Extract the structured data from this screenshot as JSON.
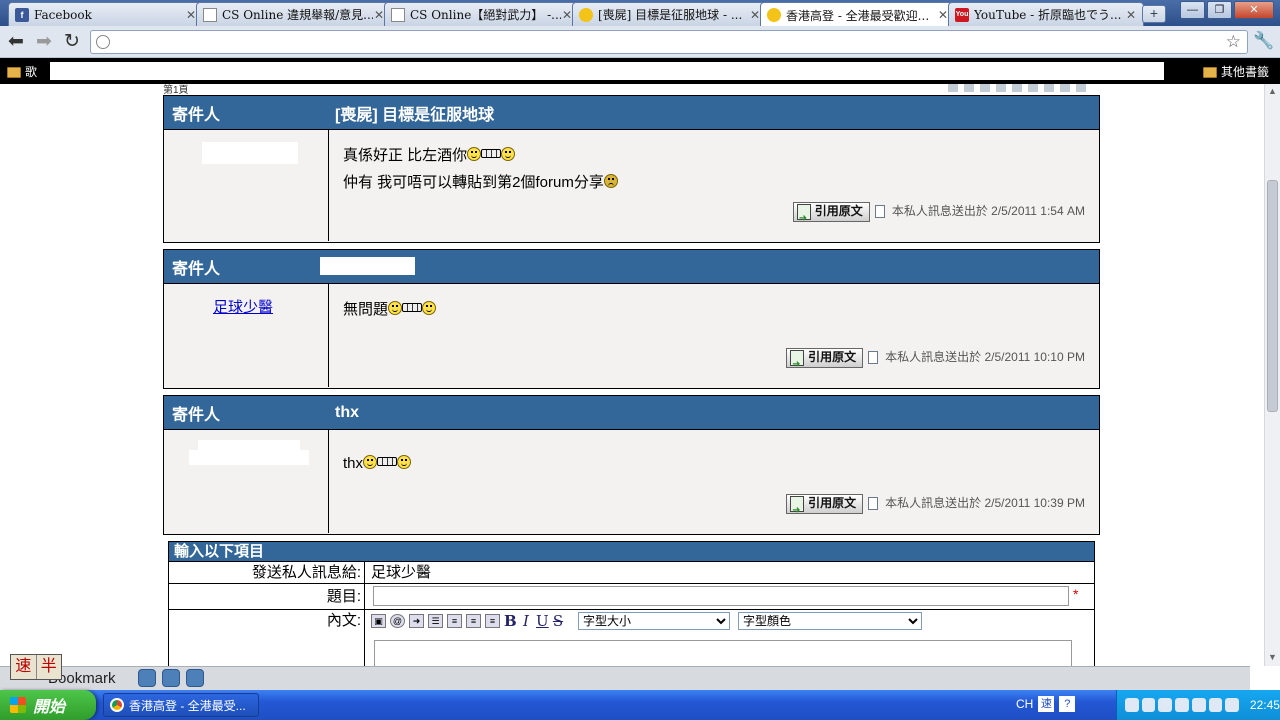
{
  "browser": {
    "tabs": [
      {
        "title": "Facebook",
        "icon": "facebook-icon",
        "active": false
      },
      {
        "title": "CS Online 違規舉報/意見...",
        "icon": "page-icon",
        "active": false
      },
      {
        "title": "CS Online【絕對武力】 -...",
        "icon": "page-icon",
        "active": false
      },
      {
        "title": "[喪屍] 目標是征服地球 - ...",
        "icon": "site-icon",
        "active": false
      },
      {
        "title": "香港高登 - 全港最受歡迎...",
        "icon": "site-icon",
        "active": true
      },
      {
        "title": "YouTube - 折原臨也でう...",
        "icon": "youtube-icon",
        "active": false
      }
    ],
    "new_tab": "+",
    "url": "",
    "bookmarks_left": "歌",
    "bookmarks_other": "其他書籤",
    "window_min": "—",
    "window_max": "❐",
    "window_close": "✕"
  },
  "page": {
    "pager_label": "第1頁",
    "messages": [
      {
        "from_label": "寄件人",
        "subject": "[喪屍] 目標是征服地球",
        "sender": "",
        "line1": "真係好正 比左酒你",
        "line2": "仲有 我可唔可以轉貼到第2個forum分享",
        "quote_label": "引用原文",
        "sent": "本私人訊息送出於 2/5/2011 1:54 AM"
      },
      {
        "from_label": "寄件人",
        "subject": "",
        "sender": "足球少醫",
        "line1": "無問題",
        "quote_label": "引用原文",
        "sent": "本私人訊息送出於 2/5/2011 10:10 PM"
      },
      {
        "from_label": "寄件人",
        "subject": "thx",
        "sender": "",
        "line1": "thx",
        "quote_label": "引用原文",
        "sent": "本私人訊息送出於 2/5/2011 10:39 PM"
      }
    ],
    "compose": {
      "header": "輸入以下項目",
      "to_label": "發送私人訊息給:",
      "to_value": "足球少醫",
      "subject_label": "題目:",
      "subject_value": "",
      "required_mark": "*",
      "body_label": "內文:",
      "font_size_selected": "字型大小",
      "font_color_selected": "字型顏色",
      "bold": "B",
      "italic": "I",
      "underline": "U",
      "strike": "S"
    }
  },
  "overlay": {
    "ime_left": "速",
    "ime_right": "半",
    "bookmark_label": "Bookmark"
  },
  "taskbar": {
    "start_label": "開始",
    "task_title": "香港高登 - 全港最受...",
    "lang": "CH",
    "clock": "22:45"
  },
  "colors": {
    "header_blue": "#336699",
    "body_bg": "#f3f2f1",
    "link": "#0000cc"
  }
}
